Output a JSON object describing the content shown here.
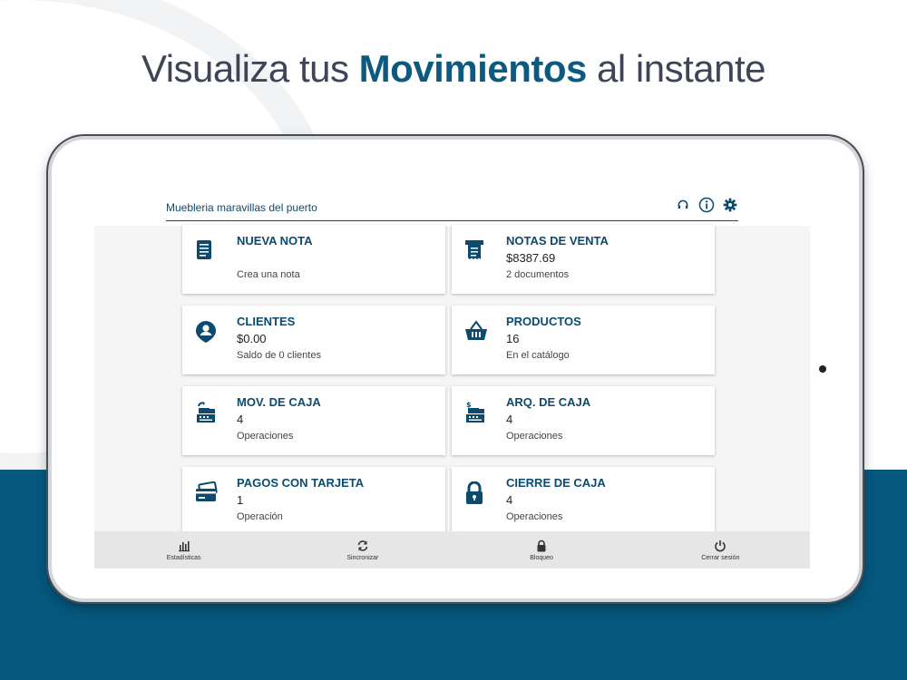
{
  "headline": {
    "part1": "Visualiza tus ",
    "strong": "Movimientos",
    "part2": " al instante"
  },
  "app": {
    "store_name": "Muebleria maravillas del puerto",
    "header_icons": [
      "headset-icon",
      "info-icon",
      "gear-icon"
    ]
  },
  "cards": [
    {
      "title": "NUEVA NOTA",
      "value": "",
      "sub": "Crea una nota",
      "icon": "note-icon"
    },
    {
      "title": "NOTAS DE VENTA",
      "value": "$8387.69",
      "sub": "2 documentos",
      "icon": "receipt-icon"
    },
    {
      "title": "CLIENTES",
      "value": "$0.00",
      "sub": "Saldo de 0 clientes",
      "icon": "user-pin-icon"
    },
    {
      "title": "PRODUCTOS",
      "value": "16",
      "sub": "En el catálogo",
      "icon": "basket-icon"
    },
    {
      "title": "MOV. DE CAJA",
      "value": "4",
      "sub": "Operaciones",
      "icon": "cash-register-icon"
    },
    {
      "title": "ARQ. DE CAJA",
      "value": "4",
      "sub": "Operaciones",
      "icon": "cash-register-dollar-icon"
    },
    {
      "title": "PAGOS CON TARJETA",
      "value": "1",
      "sub": "Operación",
      "icon": "credit-card-icon"
    },
    {
      "title": "CIERRE DE CAJA",
      "value": "4",
      "sub": "Operaciones",
      "icon": "lock-icon"
    }
  ],
  "bottom_nav": [
    {
      "label": "Estadísticas",
      "icon": "bar-chart-icon"
    },
    {
      "label": "Sincronizar",
      "icon": "sync-icon"
    },
    {
      "label": "Bloqueo",
      "icon": "lock-icon"
    },
    {
      "label": "Cerrar sesión",
      "icon": "power-icon"
    }
  ],
  "colors": {
    "brand": "#0c4a6e",
    "bottom_band": "#06587f",
    "headline_text": "#3f4556"
  }
}
